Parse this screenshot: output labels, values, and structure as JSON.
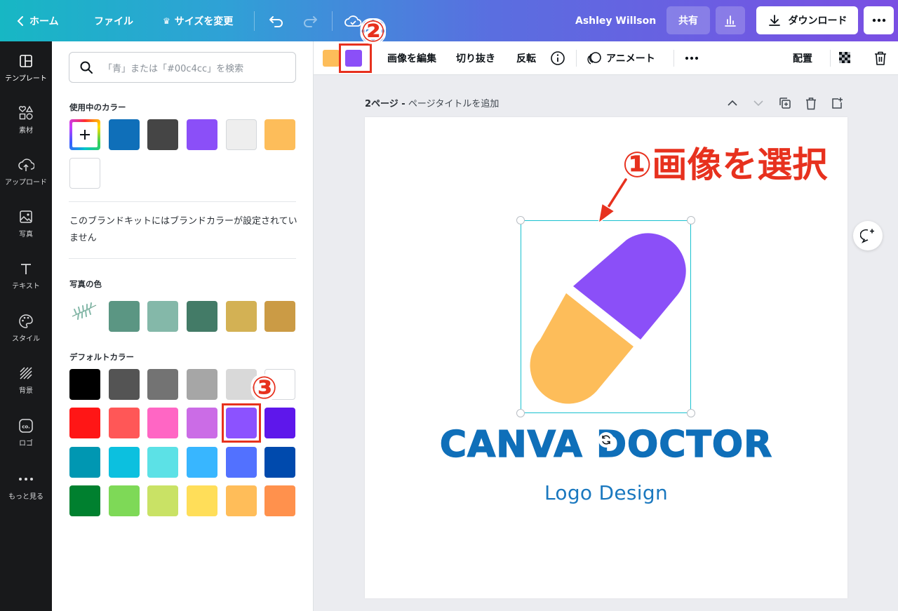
{
  "topbar": {
    "home": "ホーム",
    "file": "ファイル",
    "resize": "サイズを変更",
    "user": "Ashley Willson",
    "share": "共有",
    "download": "ダウンロード"
  },
  "rail": [
    {
      "label": "テンプレート",
      "icon": "template-icon"
    },
    {
      "label": "素材",
      "icon": "elements-icon"
    },
    {
      "label": "アップロード",
      "icon": "upload-icon"
    },
    {
      "label": "写真",
      "icon": "photo-icon"
    },
    {
      "label": "テキスト",
      "icon": "text-icon"
    },
    {
      "label": "スタイル",
      "icon": "palette-icon"
    },
    {
      "label": "背景",
      "icon": "background-icon"
    },
    {
      "label": "ロゴ",
      "icon": "logo-icon"
    },
    {
      "label": "もっと見る",
      "icon": "more-icon"
    }
  ],
  "panel": {
    "search_placeholder": "「青」または「#00c4cc」を検索",
    "in_use_title": "使用中のカラー",
    "in_use_colors": [
      "#0f6fb9",
      "#454545",
      "#8b4ff8",
      "#eeeeee",
      "#fdbd5a",
      "#ffffff"
    ],
    "brand_note": "このブランドキットにはブランドカラーが設定されていません",
    "photo_colors_title": "写真の色",
    "photo_colors": [
      "#5b9683",
      "#84b8a9",
      "#437b67",
      "#d3b154",
      "#cb9b45"
    ],
    "default_colors_title": "デフォルトカラー",
    "default_colors": [
      [
        "#000000",
        "#545454",
        "#737373",
        "#a6a6a6",
        "#d9d9d9",
        "#ffffff"
      ],
      [
        "#ff1616",
        "#ff5757",
        "#ff66c4",
        "#cb6ce6",
        "#8c52ff",
        "#5e17eb"
      ],
      [
        "#0097b2",
        "#0cc0df",
        "#5ce1e6",
        "#38b6ff",
        "#5271ff",
        "#004aad"
      ],
      [
        "#00802f",
        "#7ed957",
        "#c9e265",
        "#ffde59",
        "#ffbd59",
        "#ff914d"
      ]
    ]
  },
  "context_toolbar": {
    "swatch_colors": [
      "#fdbd5a",
      "#8b4ff8"
    ],
    "edit_image": "画像を編集",
    "crop": "切り抜き",
    "flip": "反転",
    "animate": "アニメート",
    "position": "配置"
  },
  "canvas": {
    "page_number": "2ページ -",
    "page_title_placeholder": "ページタイトルを追加",
    "logo_title": "CANVA DOCTOR",
    "logo_subtitle": "Logo Design",
    "capsule_colors": [
      "#8b4ff8",
      "#fdbd5a"
    ]
  },
  "annotations": {
    "step1": "①画像を選択",
    "step2": "②",
    "step3": "③"
  }
}
